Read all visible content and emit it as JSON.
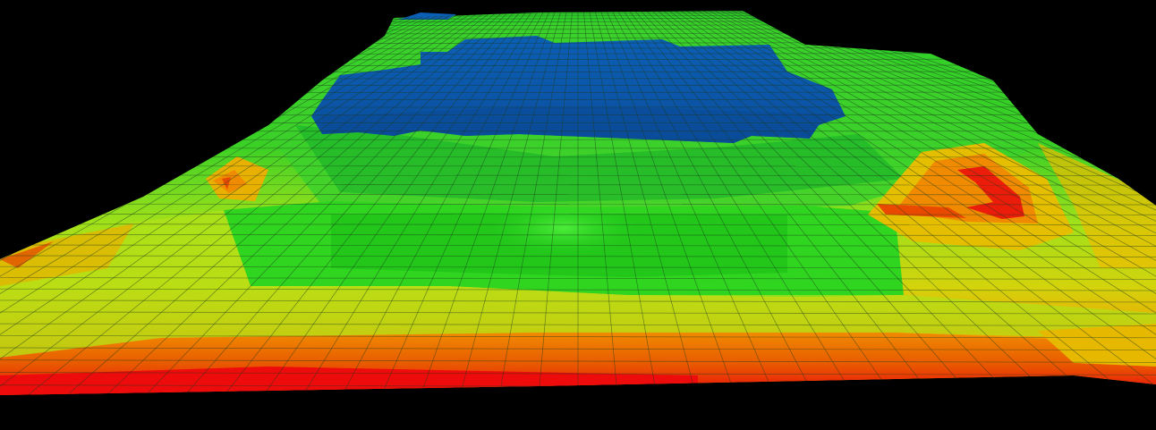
{
  "scene": {
    "background_color": "#000000",
    "surface": "3d-colored-terrain-mesh",
    "colormap": [
      "#ff0000",
      "#ff6a00",
      "#ffb300",
      "#b5e600",
      "#2bdc00",
      "#00c85a",
      "#0a5ab4"
    ],
    "colors": {
      "blue": "#0b55a8",
      "deep_blue": "#094a95",
      "green": "#21cf1e",
      "bright_green": "#36e42a",
      "yellow_green": "#a6e31a",
      "yellow": "#e8c200",
      "orange": "#ef8a00",
      "dark_orange": "#e05a00",
      "red": "#ee0b0b",
      "grid_line": "#1d3a1d"
    },
    "grid": true,
    "legend": false
  }
}
